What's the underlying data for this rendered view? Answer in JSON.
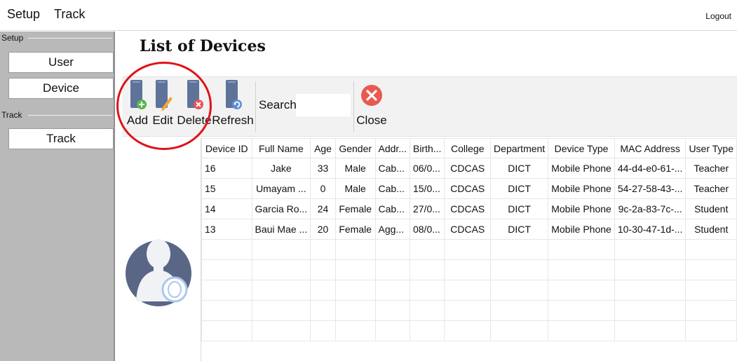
{
  "menubar": {
    "items": [
      "Setup",
      "Track"
    ],
    "logout_label": "Logout"
  },
  "sidebar": {
    "groups": [
      {
        "title": "Setup",
        "items": [
          "User",
          "Device"
        ]
      },
      {
        "title": "Track",
        "items": [
          "Track"
        ]
      }
    ]
  },
  "page": {
    "title": "List of Devices"
  },
  "toolbar": {
    "add_label": "Add",
    "edit_label": "Edit",
    "delete_label": "Delete",
    "refresh_label": "Refresh",
    "search_label": "Search:",
    "search_value": "",
    "close_label": "Close"
  },
  "table": {
    "columns": [
      "Device ID",
      "Full Name",
      "Age",
      "Gender",
      "Addr...",
      "Birth...",
      "College",
      "Department",
      "Device Type",
      "MAC Address",
      "User Type"
    ],
    "rows": [
      [
        "16",
        "Jake",
        "33",
        "Male",
        "Cab...",
        "06/0...",
        "CDCAS",
        "DICT",
        "Mobile Phone",
        "44-d4-e0-61-...",
        "Teacher"
      ],
      [
        "15",
        "Umayam ...",
        "0",
        "Male",
        "Cab...",
        "15/0...",
        "CDCAS",
        "DICT",
        "Mobile Phone",
        "54-27-58-43-...",
        "Teacher"
      ],
      [
        "14",
        "Garcia Ro...",
        "24",
        "Female",
        "Cab...",
        "27/0...",
        "CDCAS",
        "DICT",
        "Mobile Phone",
        "9c-2a-83-7c-...",
        "Student"
      ],
      [
        "13",
        "Baui Mae ...",
        "20",
        "Female",
        "Agg...",
        "08/0...",
        "CDCAS",
        "DICT",
        "Mobile Phone",
        "10-30-47-1d-...",
        "Student"
      ]
    ],
    "empty_rows": 5
  },
  "colors": {
    "sidebar_bg": "#b9b9b9",
    "toolbar_bg": "#f2f2f2",
    "phone_icon": "#5f7299",
    "add_badge": "#54b848",
    "edit_pencil": "#f2a93b",
    "delete_badge": "#e85454",
    "refresh_badge": "#5b8fd6",
    "close_button": "#e85a50",
    "highlight_ring": "#e0121a",
    "avatar": "#5a6685"
  },
  "icons": {
    "add": "phone-add-icon",
    "edit": "phone-edit-icon",
    "delete": "phone-delete-icon",
    "refresh": "phone-refresh-icon",
    "close": "close-circle-icon",
    "avatar": "user-avatar-icon"
  }
}
